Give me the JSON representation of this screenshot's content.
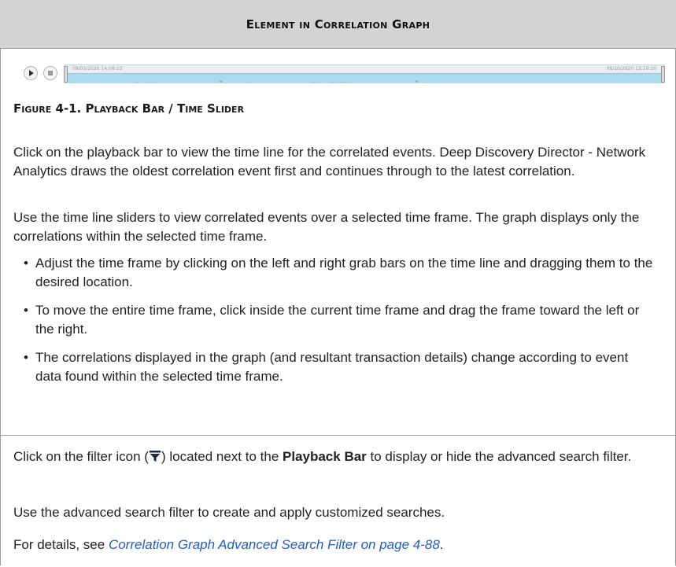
{
  "header": {
    "title": "Element in Correlation Graph"
  },
  "playback": {
    "start_time": "08/03/2020 14:08:23",
    "end_time": "08/10/2020 13:19:10"
  },
  "figure": {
    "caption": "Figure 4-1. Playback Bar / Time Slider"
  },
  "content": {
    "para1": "Click on the playback bar to view the time line for the correlated events. Deep Discovery Director - Network Analytics draws the oldest correlation event first and continues through to the latest correlation.",
    "para2": "Use the time line sliders to view correlated events over a selected time frame. The graph displays only the correlations within the selected time frame.",
    "bullets": [
      "Adjust the time frame by clicking on the left and right grab bars on the time line and dragging them to the desired location.",
      "To move the entire time frame, click inside the current time frame and drag the frame toward the left or the right.",
      "The correlations displayed in the graph (and resultant transaction details) change according to event data found within the selected time frame."
    ]
  },
  "lower": {
    "filter_pre": "Click on the filter icon (",
    "filter_mid": ") located next to the ",
    "filter_bold": "Playback Bar",
    "filter_post": " to display or hide the advanced search filter.",
    "para_use": "Use the advanced search filter to create and apply customized searches.",
    "details_pre": "For details, see ",
    "details_link": "Correlation Graph Advanced Search Filter on page 4-88",
    "details_post": "."
  },
  "icons": {
    "filter": "filter-funnel-icon",
    "play": "play-icon",
    "stop": "stop-icon"
  },
  "colors": {
    "header_bg": "#d3d3d3",
    "track_fill": "#a9dbf0",
    "link": "#1f5fbf"
  }
}
